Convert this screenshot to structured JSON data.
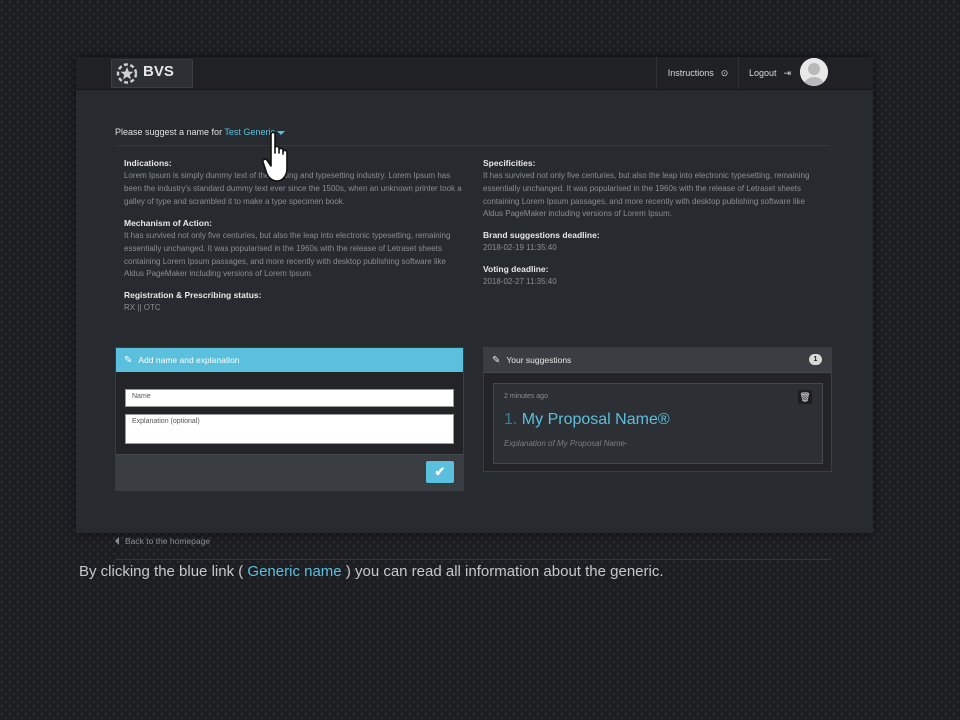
{
  "header": {
    "brand": "BVS",
    "instructions_label": "Instructions",
    "logout_label": "Logout"
  },
  "intro": {
    "prefix": "Please suggest a name for",
    "generic_link": "Test Generic"
  },
  "left_info": [
    {
      "title": "Indications:",
      "text": "Lorem Ipsum is simply dummy text of the printing and typesetting industry. Lorem Ipsum has been the industry's standard dummy text ever since the 1500s, when an unknown printer took a galley of type and scrambled it to make a type specimen book."
    },
    {
      "title": "Mechanism of Action:",
      "text": "It has survived not only five centuries, but also the leap into electronic typesetting, remaining essentially unchanged. It was popularised in the 1960s with the release of Letraset sheets containing Lorem Ipsum passages, and more recently with desktop publishing software like Aldus PageMaker including versions of Lorem Ipsum."
    },
    {
      "title": "Registration & Prescribing status:",
      "text": "RX || OTC"
    }
  ],
  "right_info": [
    {
      "title": "Specificities:",
      "text": "It has survived not only five centuries, but also the leap into electronic typesetting, remaining essentially unchanged. It was popularised in the 1960s with the release of Letraset sheets containing Lorem Ipsum passages, and more recently with desktop publishing software like Aldus PageMaker including versions of Lorem Ipsum."
    },
    {
      "title": "Brand suggestions deadline:",
      "text": "2018-02-19 11:35:40"
    },
    {
      "title": "Voting deadline:",
      "text": "2018-02-27 11:35:40"
    }
  ],
  "add_panel": {
    "title": "Add name and explanation",
    "name_placeholder": "Name",
    "explanation_placeholder": "Explanation (optional)"
  },
  "suggestions_panel": {
    "title": "Your suggestions",
    "count": "1",
    "items": [
      {
        "time": "2 minutes ago",
        "number": "1.",
        "name": "My Proposal Name®",
        "explanation": "Explanation of My Proposal Name-"
      }
    ]
  },
  "back_link": "Back to the homepage",
  "caption": {
    "before": "By clicking the blue link (",
    "link": "Generic name",
    "after": ") you can read all information about the generic."
  },
  "colors": {
    "accent": "#5bc0de",
    "panel_bg": "#272a2e",
    "topbar_bg": "#1f2124"
  }
}
